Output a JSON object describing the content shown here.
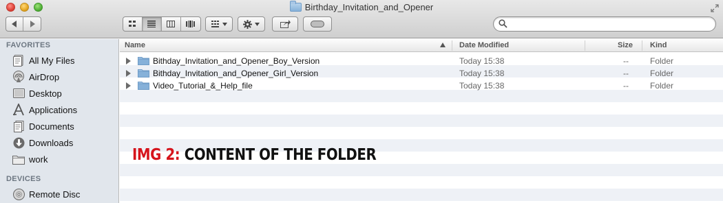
{
  "window": {
    "title": "Birthday_Invitation_and_Opener",
    "traffic_lights": [
      "close",
      "minimize",
      "zoom"
    ]
  },
  "toolbar": {
    "nav": [
      "back-icon",
      "forward-icon"
    ],
    "view_modes": [
      "icon-view-icon",
      "list-view-icon",
      "column-view-icon",
      "coverflow-view-icon"
    ],
    "active_view": "list-view-icon",
    "arrange": "arrange-icon",
    "action": "gear-icon",
    "share": "share-icon",
    "tags": "tag-icon",
    "search": {
      "value": "",
      "placeholder": ""
    }
  },
  "sidebar": {
    "sections": [
      {
        "header": "FAVORITES",
        "items": [
          {
            "label": "All My Files",
            "icon": "all-files-icon"
          },
          {
            "label": "AirDrop",
            "icon": "airdrop-icon"
          },
          {
            "label": "Desktop",
            "icon": "desktop-icon"
          },
          {
            "label": "Applications",
            "icon": "applications-icon"
          },
          {
            "label": "Documents",
            "icon": "documents-icon"
          },
          {
            "label": "Downloads",
            "icon": "downloads-icon"
          },
          {
            "label": "work",
            "icon": "folder-icon"
          }
        ]
      },
      {
        "header": "DEVICES",
        "items": [
          {
            "label": "Remote Disc",
            "icon": "disc-icon"
          }
        ]
      }
    ]
  },
  "list": {
    "columns": {
      "name": "Name",
      "date": "Date Modified",
      "size": "Size",
      "kind": "Kind"
    },
    "sort_column": "Name",
    "rows": [
      {
        "name": "Bithday_Invitation_and_Opener_Boy_Version",
        "date": "Today 15:38",
        "size": "--",
        "kind": "Folder"
      },
      {
        "name": "Bithday_Invitation_and_Opener_Girl_Version",
        "date": "Today 15:38",
        "size": "--",
        "kind": "Folder"
      },
      {
        "name": "Video_Tutorial_&_Help_file",
        "date": "Today 15:38",
        "size": "--",
        "kind": "Folder"
      }
    ]
  },
  "caption": {
    "prefix": "IMG 2:",
    "text": "CONTENT OF THE FOLDER"
  },
  "colors": {
    "caption_red": "#d6141c",
    "sidebar_bg": "#e1e6ec",
    "folder_blue": "#86b1d9",
    "stripe": "#eef1f6"
  }
}
